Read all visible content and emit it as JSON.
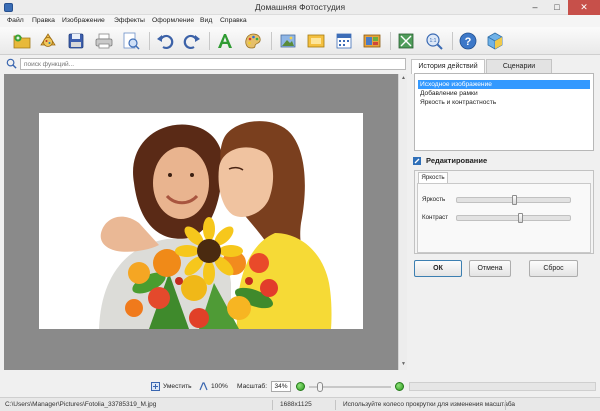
{
  "window": {
    "title": "Домашняя Фотостудия"
  },
  "menu": [
    "Файл",
    "Правка",
    "Изображение",
    "Эффекты",
    "Оформление",
    "Вид",
    "Справка"
  ],
  "toolbar_icons": [
    "open-file-icon",
    "gallery-icon",
    "save-icon",
    "print-icon",
    "preview-icon",
    "undo-icon",
    "redo-icon",
    "text-icon",
    "palette-icon",
    "image-frame-icon",
    "postcard-icon",
    "calendar-icon",
    "collage-icon",
    "crop-icon",
    "zoom-100-icon",
    "help-icon",
    "package-icon"
  ],
  "search": {
    "placeholder": "поиск функций..."
  },
  "panel": {
    "tabs": [
      "История действий",
      "Сценарии"
    ],
    "history": [
      "Исходное изображение",
      "Добавление рамки",
      "Яркость и контрастность"
    ],
    "history_selected": 0,
    "edit_title": "Редактирование",
    "edit_tab": "Яркость",
    "sliders": [
      {
        "label": "Яркость",
        "value": 0.5
      },
      {
        "label": "Контраст",
        "value": 0.55
      }
    ],
    "buttons": {
      "ok": "ОК",
      "cancel": "Отмена",
      "reset": "Сброс"
    }
  },
  "zoombar": {
    "fit_label": "Уместить",
    "actual_label": "100%",
    "zoom_label": "Масштаб:",
    "zoom_value": "34%",
    "zoom_slider": 0.1
  },
  "status": {
    "path": "C:\\Users\\Manager\\Pictures\\Fotolia_33785319_M.jpg",
    "dimensions": "1688x1125",
    "hint": "Используйте колесо прокрутки для изменения масштаба"
  },
  "colors": {
    "selection": "#3399ff",
    "canvas_bg": "#8a8a8a",
    "close_btn": "#c7504a"
  }
}
